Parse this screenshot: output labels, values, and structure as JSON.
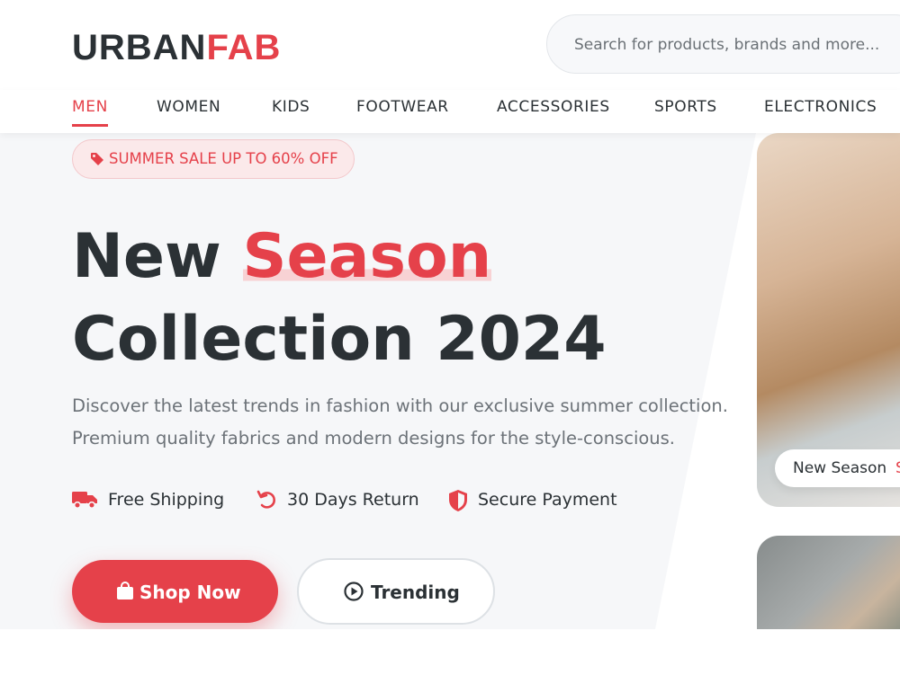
{
  "brand": {
    "part1": "URBAN",
    "part2": "FAB",
    "color": "#e5414a"
  },
  "search": {
    "placeholder": "Search for products, brands and more..."
  },
  "nav": {
    "items": [
      {
        "label": "MEN",
        "active": true
      },
      {
        "label": "WOMEN"
      },
      {
        "label": "KIDS"
      },
      {
        "label": "FOOTWEAR"
      },
      {
        "label": "ACCESSORIES"
      },
      {
        "label": "SPORTS"
      },
      {
        "label": "ELECTRONICS"
      }
    ]
  },
  "hero": {
    "badge": {
      "icon": "tag-icon",
      "text": "SUMMER SALE UP TO 60% OFF"
    },
    "title": {
      "word1": "New ",
      "highlight": "Season",
      "line2": "Collection 2024"
    },
    "description": {
      "line1": "Discover the latest trends in fashion with our exclusive summer collection.",
      "line2": "Premium quality fabrics and modern designs for the style-conscious."
    },
    "features": [
      {
        "icon": "truck-icon",
        "label": "Free Shipping"
      },
      {
        "icon": "return-icon",
        "label": "30 Days Return"
      },
      {
        "icon": "shield-icon",
        "label": "Secure Payment"
      }
    ],
    "buttons": {
      "primary": {
        "icon": "shopping-bag-icon",
        "label": "Shop Now"
      },
      "secondary": {
        "icon": "play-circle-icon",
        "label": "Trending"
      }
    },
    "image_card": {
      "tag_label": "New Season",
      "tag_label_rest": "S"
    }
  },
  "colors": {
    "accent": "#e5414a",
    "text": "#2b3135",
    "muted": "#6c7278",
    "hero_bg": "#f6f7f9"
  }
}
